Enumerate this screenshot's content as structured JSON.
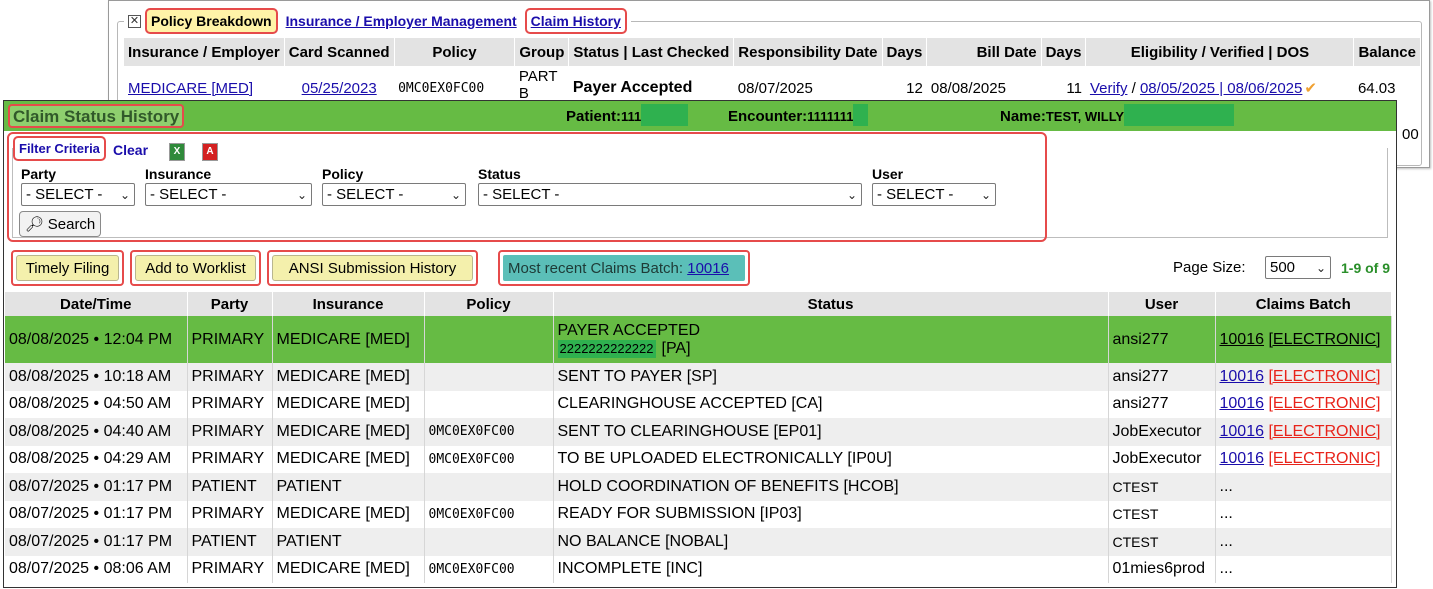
{
  "policy_window": {
    "tabs": [
      "Policy Breakdown",
      "Insurance / Employer Management",
      "Claim History"
    ],
    "columns": [
      "Insurance / Employer",
      "Card Scanned",
      "Policy",
      "Group",
      "Status | Last Checked",
      "Responsibility Date",
      "Days",
      "Bill Date",
      "Days",
      "Eligibility / Verified | DOS",
      "Balance"
    ],
    "row": {
      "insurance": "MEDICARE [MED]",
      "card_scanned": "05/25/2023",
      "policy": "0MC0EX0FC00",
      "group": "PART B",
      "status": "Payer Accepted",
      "responsibility_date": "08/07/2025",
      "days1": "12",
      "bill_date": "08/08/2025",
      "days2": "11",
      "verify": "Verify",
      "sep": "/",
      "dos": "08/05/2025 | 08/06/2025",
      "balance": "64.03",
      "balance_partial": "00"
    }
  },
  "csh": {
    "title": "Claim Status History",
    "patient_label": "Patient:",
    "patient_value": "111",
    "encounter_label": "Encounter:",
    "encounter_value": "1111111",
    "name_label": "Name:",
    "name_value": "TEST, WILLY",
    "filter": {
      "legend": "Filter Criteria",
      "clear": "Clear",
      "excel_icon": "X",
      "pdf_icon": "A",
      "labels": {
        "party": "Party",
        "insurance": "Insurance",
        "policy": "Policy",
        "status": "Status",
        "user": "User"
      },
      "select_default": "- SELECT -",
      "search": "Search"
    },
    "buttons": {
      "timely_filing": "Timely Filing",
      "add_to_worklist": "Add to Worklist",
      "ansi_history": "ANSI Submission History"
    },
    "batch": {
      "label": "Most recent Claims Batch:",
      "value": "10016"
    },
    "page_size": {
      "label": "Page Size:",
      "value": "500",
      "count": "1-9 of 9"
    },
    "table": {
      "columns": [
        "Date/Time",
        "Party",
        "Insurance",
        "Policy",
        "Status",
        "User",
        "Claims Batch"
      ],
      "rows": [
        {
          "datetime": "08/08/2025 • 12:04 PM",
          "party": "PRIMARY",
          "insurance": "MEDICARE [MED]",
          "policy": "",
          "status": "PAYER ACCEPTED",
          "status_ref": "2222222222222",
          "status_ref_code": "[PA]",
          "user": "ansi277",
          "batch": "10016",
          "batch_type": "[ELECTRONIC]"
        },
        {
          "datetime": "08/08/2025 • 10:18 AM",
          "party": "PRIMARY",
          "insurance": "MEDICARE [MED]",
          "policy": "",
          "status": "SENT TO PAYER [SP]",
          "user": "ansi277",
          "batch": "10016",
          "batch_type": "[ELECTRONIC]"
        },
        {
          "datetime": "08/08/2025 • 04:50 AM",
          "party": "PRIMARY",
          "insurance": "MEDICARE [MED]",
          "policy": "",
          "status": "CLEARINGHOUSE ACCEPTED [CA]",
          "user": "ansi277",
          "batch": "10016",
          "batch_type": "[ELECTRONIC]"
        },
        {
          "datetime": "08/08/2025 • 04:40 AM",
          "party": "PRIMARY",
          "insurance": "MEDICARE [MED]",
          "policy": "0MC0EX0FC00",
          "status": "SENT TO CLEARINGHOUSE [EP01]",
          "user": "JobExecutor",
          "batch": "10016",
          "batch_type": "[ELECTRONIC]"
        },
        {
          "datetime": "08/08/2025 • 04:29 AM",
          "party": "PRIMARY",
          "insurance": "MEDICARE [MED]",
          "policy": "0MC0EX0FC00",
          "status": "TO BE UPLOADED ELECTRONICALLY [IP0U]",
          "user": "JobExecutor",
          "batch": "10016",
          "batch_type": "[ELECTRONIC]"
        },
        {
          "datetime": "08/07/2025 • 01:17 PM",
          "party": "PATIENT",
          "insurance": "PATIENT",
          "policy": "",
          "status": "HOLD COORDINATION OF BENEFITS [HCOB]",
          "user": "CTEST",
          "batch_text": "..."
        },
        {
          "datetime": "08/07/2025 • 01:17 PM",
          "party": "PRIMARY",
          "insurance": "MEDICARE [MED]",
          "policy": "0MC0EX0FC00",
          "status": "READY FOR SUBMISSION [IP03]",
          "user": "CTEST",
          "batch_text": "..."
        },
        {
          "datetime": "08/07/2025 • 01:17 PM",
          "party": "PATIENT",
          "insurance": "PATIENT",
          "policy": "",
          "status": "NO BALANCE [NOBAL]",
          "user": "CTEST",
          "batch_text": "..."
        },
        {
          "datetime": "08/07/2025 • 08:06 AM",
          "party": "PRIMARY",
          "insurance": "MEDICARE [MED]",
          "policy": "0MC0EX0FC00",
          "status": "INCOMPLETE [INC]",
          "user": "01mies6prod",
          "batch_text": "..."
        }
      ]
    }
  },
  "colors": {
    "header_green": "#66bb44",
    "highlight_red": "#e64b4b",
    "button_yellow": "#f4f0ac",
    "batch_teal": "#5bbfb8"
  },
  "icons": {
    "collapse": "collapse-box-icon",
    "search": "magnifier-icon",
    "check": "checkmark-icon",
    "dropdown": "chevron-down-icon"
  }
}
